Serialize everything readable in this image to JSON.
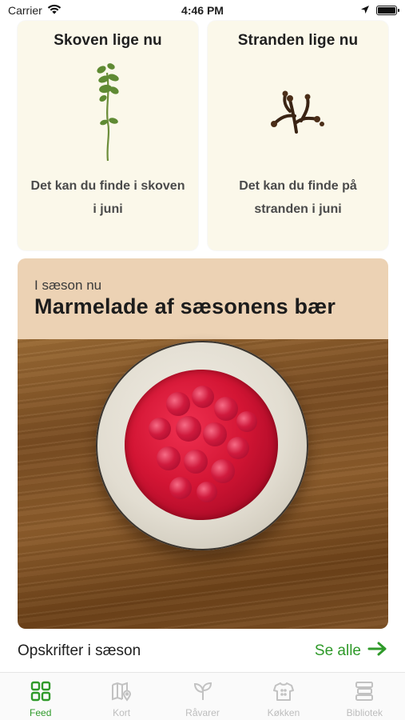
{
  "status_bar": {
    "carrier": "Carrier",
    "time": "4:46 PM"
  },
  "top_cards": [
    {
      "title": "Skoven lige nu",
      "text": "Det kan du finde i skoven i juni",
      "icon": "herb-sprig"
    },
    {
      "title": "Stranden lige nu",
      "text": "Det kan du finde på stranden i juni",
      "icon": "seaweed"
    }
  ],
  "season": {
    "kicker": "I sæson nu",
    "title": "Marmelade af sæsonens bær",
    "header_color": "#ecd2b4"
  },
  "recipes": {
    "title": "Opskrifter i sæson",
    "see_all": "Se alle"
  },
  "tabs": [
    {
      "label": "Feed",
      "icon": "grid-icon",
      "active": true
    },
    {
      "label": "Kort",
      "icon": "map-pin-icon",
      "active": false
    },
    {
      "label": "Råvarer",
      "icon": "sprout-icon",
      "active": false
    },
    {
      "label": "Køkken",
      "icon": "chef-shirt-icon",
      "active": false
    },
    {
      "label": "Bibliotek",
      "icon": "library-icon",
      "active": false
    }
  ],
  "colors": {
    "accent": "#2f9a2a",
    "card_bg": "#fbf8ea",
    "inactive": "#bdbdbd"
  }
}
